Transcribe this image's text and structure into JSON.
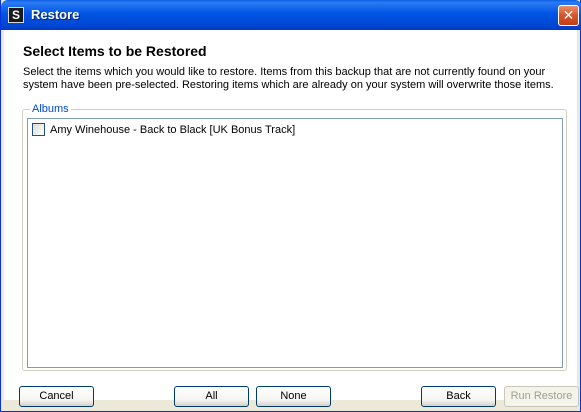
{
  "window": {
    "title": "Restore",
    "app_icon_letter": "S",
    "close_glyph": "✕"
  },
  "heading": "Select Items to be Restored",
  "description": "Select the items which you would like to restore. Items from this backup that are not currently found on your system have been pre-selected. Restoring items which are already on your system will overwrite those items.",
  "albums": {
    "legend": "Albums",
    "items": [
      {
        "label": "Amy Winehouse - Back to Black [UK Bonus Track]",
        "checked": false
      }
    ]
  },
  "buttons": {
    "cancel": "Cancel",
    "all": "All",
    "none": "None",
    "back": "Back",
    "run_restore": "Run Restore"
  },
  "colors": {
    "titlebar": "#0055E5",
    "legend": "#0046D5",
    "close": "#D8542A"
  }
}
